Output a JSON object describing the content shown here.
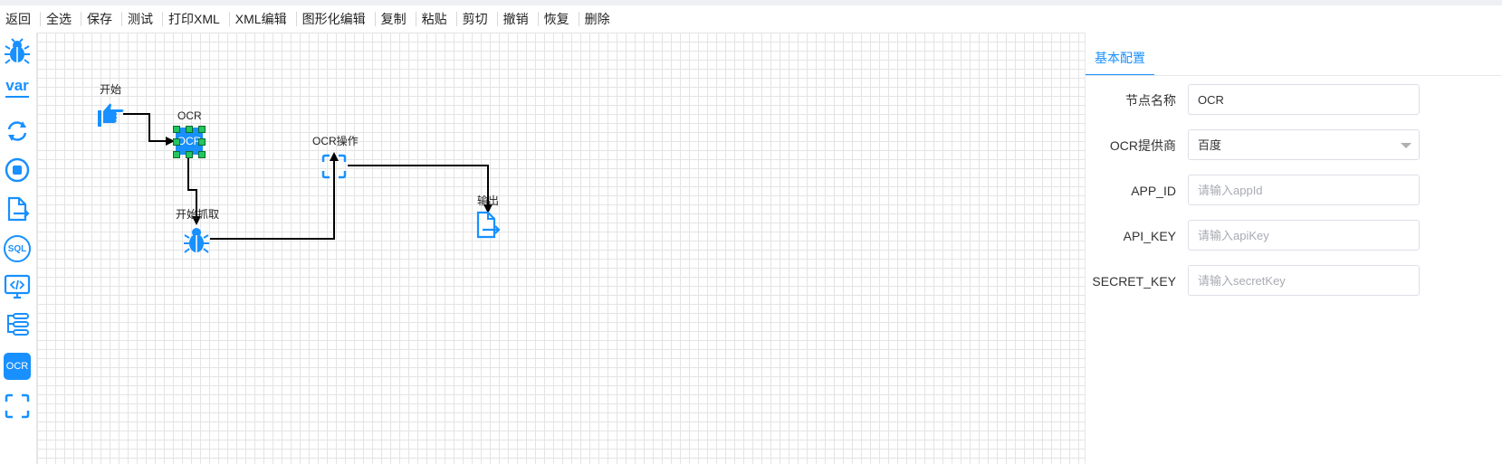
{
  "toolbar": {
    "items": [
      "返回",
      "全选",
      "保存",
      "测试",
      "打印XML",
      "XML编辑",
      "图形化编辑",
      "复制",
      "粘贴",
      "剪切",
      "撤销",
      "恢复",
      "删除"
    ]
  },
  "sidebar": {
    "items": [
      {
        "name": "bug-icon"
      },
      {
        "name": "variable-icon",
        "text": "var"
      },
      {
        "name": "loop-icon"
      },
      {
        "name": "stop-icon"
      },
      {
        "name": "output-file-icon"
      },
      {
        "name": "sql-icon",
        "text": "SQL"
      },
      {
        "name": "code-monitor-icon"
      },
      {
        "name": "process-icon"
      },
      {
        "name": "ocr-icon",
        "text": "OCR"
      },
      {
        "name": "scan-icon"
      }
    ]
  },
  "canvas": {
    "nodes": {
      "start": {
        "label": "开始",
        "icon": "pointing-hand-icon"
      },
      "ocr": {
        "label": "OCR",
        "icon_text": "OCR"
      },
      "crawl": {
        "label": "开始抓取",
        "icon": "bug-icon"
      },
      "ocr_op": {
        "label": "OCR操作",
        "icon": "scan-icon"
      },
      "output": {
        "label": "输出",
        "icon": "output-file-icon"
      }
    }
  },
  "panel": {
    "tab": "基本配置",
    "fields": {
      "node_name": {
        "label": "节点名称",
        "value": "OCR"
      },
      "provider": {
        "label": "OCR提供商",
        "value": "百度"
      },
      "app_id": {
        "label": "APP_ID",
        "placeholder": "请输入appId"
      },
      "api_key": {
        "label": "API_KEY",
        "placeholder": "请输入apiKey"
      },
      "secret_key": {
        "label": "SECRET_KEY",
        "placeholder": "请输入secretKey"
      }
    }
  },
  "colors": {
    "accent": "#1890ff",
    "handle": "#22c55e"
  }
}
